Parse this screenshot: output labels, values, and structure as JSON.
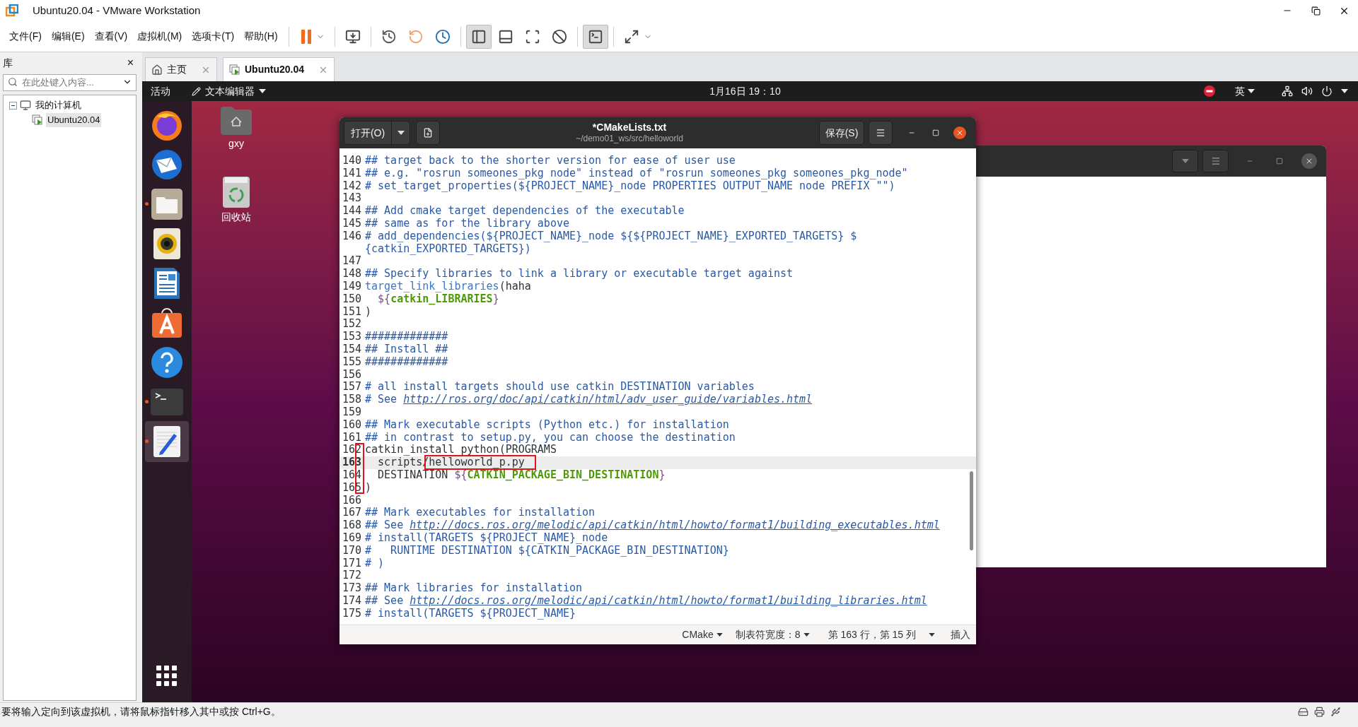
{
  "window": {
    "title": "Ubuntu20.04 - VMware Workstation"
  },
  "menu": [
    "文件(F)",
    "编辑(E)",
    "查看(V)",
    "虚拟机(M)",
    "选项卡(T)",
    "帮助(H)"
  ],
  "toolbar": [
    {
      "kind": "pause",
      "selected": false
    },
    {
      "kind": "ctrl-alt-del",
      "selected": false
    },
    {
      "kind": "snapshot-take",
      "selected": false
    },
    {
      "kind": "snapshot-revert",
      "selected": false
    },
    {
      "kind": "snapshot-manager",
      "selected": false
    },
    {
      "kind": "view-library",
      "selected": true
    },
    {
      "kind": "view-thumbnails",
      "selected": false
    },
    {
      "kind": "view-fullscreen",
      "selected": false
    },
    {
      "kind": "view-unity",
      "selected": false
    },
    {
      "kind": "console",
      "selected": true
    },
    {
      "kind": "stretch",
      "selected": false
    }
  ],
  "library": {
    "title": "库",
    "close": "×",
    "search": {
      "placeholder": "在此处键入内容..."
    },
    "tree": [
      {
        "label": "我的计算机",
        "expanded": true,
        "selected": false,
        "children": [
          {
            "label": "Ubuntu20.04",
            "selected": true
          }
        ]
      }
    ]
  },
  "tabs": [
    {
      "label": "主页",
      "kind": "home",
      "selected": false
    },
    {
      "label": "Ubuntu20.04",
      "kind": "vm",
      "selected": true
    }
  ],
  "ubuntu_bar": {
    "activities": "活动",
    "app_menu": "文本编辑器",
    "clock": "1月16日 19：10",
    "input_method": "英"
  },
  "dock": [
    {
      "kind": "browser",
      "running": false,
      "selected": false
    },
    {
      "kind": "mail",
      "running": false,
      "selected": false
    },
    {
      "kind": "files",
      "running": true,
      "selected": false
    },
    {
      "kind": "music",
      "running": false,
      "selected": false
    },
    {
      "kind": "writer",
      "running": false,
      "selected": false
    },
    {
      "kind": "software",
      "running": false,
      "selected": false
    },
    {
      "kind": "help",
      "running": false,
      "selected": false
    },
    {
      "kind": "terminal",
      "running": true,
      "selected": false
    },
    {
      "kind": "editor",
      "running": true,
      "selected": true
    }
  ],
  "desktop_icons": [
    {
      "kind": "home",
      "label": "gxy"
    },
    {
      "kind": "trash",
      "label": "回收站"
    }
  ],
  "editor": {
    "open_button": "打开(O)",
    "title": "*CMakeLists.txt",
    "subtitle": "~/demo01_ws/src/helloworld",
    "save_button": "保存(S)",
    "lines": [
      {
        "number": "140",
        "segments": [
          {
            "kind": "comment",
            "text": "## target back to the shorter version for ease of user use"
          }
        ]
      },
      {
        "number": "141",
        "segments": [
          {
            "kind": "comment",
            "text": "## e.g. \"rosrun someones_pkg node\" instead of \"rosrun someones_pkg someones_pkg_node\""
          }
        ]
      },
      {
        "number": "142",
        "segments": [
          {
            "kind": "comment",
            "text": "# set_target_properties(${PROJECT_NAME}_node PROPERTIES OUTPUT_NAME node PREFIX \"\")"
          }
        ]
      },
      {
        "number": "143"
      },
      {
        "number": "144",
        "segments": [
          {
            "kind": "comment",
            "text": "## Add cmake target dependencies of the executable"
          }
        ]
      },
      {
        "number": "145",
        "segments": [
          {
            "kind": "comment",
            "text": "## same as for the library above"
          }
        ]
      },
      {
        "number": "146",
        "segments": [
          {
            "kind": "comment",
            "text": "# add_dependencies(${PROJECT_NAME}_node ${${PROJECT_NAME}_EXPORTED_TARGETS} $"
          }
        ]
      },
      {
        "segments": [
          {
            "kind": "comment",
            "text": "{catkin_EXPORTED_TARGETS})"
          }
        ]
      },
      {
        "number": "147"
      },
      {
        "number": "148",
        "segments": [
          {
            "kind": "comment",
            "text": "## Specify libraries to link a library or executable target against"
          }
        ]
      },
      {
        "number": "149",
        "segments": [
          {
            "kind": "function",
            "text": "target_link_libraries"
          },
          {
            "kind": "plain",
            "text": "(haha"
          }
        ]
      },
      {
        "number": "150",
        "segments": [
          {
            "kind": "brace",
            "text": "  ${"
          },
          {
            "kind": "variable",
            "text": "catkin_LIBRARIES"
          },
          {
            "kind": "brace",
            "text": "}"
          }
        ]
      },
      {
        "number": "151",
        "segments": [
          {
            "kind": "plain",
            "text": ")"
          }
        ]
      },
      {
        "number": "152"
      },
      {
        "number": "153",
        "segments": [
          {
            "kind": "comment",
            "text": "#############"
          }
        ]
      },
      {
        "number": "154",
        "segments": [
          {
            "kind": "comment",
            "text": "## Install ##"
          }
        ]
      },
      {
        "number": "155",
        "segments": [
          {
            "kind": "comment",
            "text": "#############"
          }
        ]
      },
      {
        "number": "156"
      },
      {
        "number": "157",
        "segments": [
          {
            "kind": "comment",
            "text": "# all install targets should use catkin DESTINATION variables"
          }
        ]
      },
      {
        "number": "158",
        "segments": [
          {
            "kind": "comment",
            "text": "# See "
          },
          {
            "kind": "link",
            "text": "http://ros.org/doc/api/catkin/html/adv_user_guide/variables.html"
          }
        ]
      },
      {
        "number": "159"
      },
      {
        "number": "160",
        "segments": [
          {
            "kind": "comment",
            "text": "## Mark executable scripts (Python etc.) for installation"
          }
        ]
      },
      {
        "number": "161",
        "segments": [
          {
            "kind": "comment",
            "text": "## in contrast to setup.py, you can choose the destination"
          }
        ]
      },
      {
        "number": "162",
        "segments": [
          {
            "kind": "plain",
            "text": "catkin_install_python(PROGRAMS"
          }
        ]
      },
      {
        "number": "163",
        "current": true,
        "segments": [
          {
            "kind": "plain",
            "text": "  scripts/helloworld_p.py"
          }
        ]
      },
      {
        "number": "164",
        "segments": [
          {
            "kind": "plain",
            "text": "  DESTINATION "
          },
          {
            "kind": "brace",
            "text": "${"
          },
          {
            "kind": "variable",
            "text": "CATKIN_PACKAGE_BIN_DESTINATION"
          },
          {
            "kind": "brace",
            "text": "}"
          }
        ]
      },
      {
        "number": "165",
        "segments": [
          {
            "kind": "plain",
            "text": ")"
          }
        ]
      },
      {
        "number": "166"
      },
      {
        "number": "167",
        "segments": [
          {
            "kind": "comment",
            "text": "## Mark executables for installation"
          }
        ]
      },
      {
        "number": "168",
        "segments": [
          {
            "kind": "comment",
            "text": "## See "
          },
          {
            "kind": "link",
            "text": "http://docs.ros.org/melodic/api/catkin/html/howto/format1/building_executables.html"
          }
        ]
      },
      {
        "number": "169",
        "segments": [
          {
            "kind": "comment",
            "text": "# install(TARGETS ${PROJECT_NAME}_node"
          }
        ]
      },
      {
        "number": "170",
        "segments": [
          {
            "kind": "comment",
            "text": "#   RUNTIME DESTINATION ${CATKIN_PACKAGE_BIN_DESTINATION}"
          }
        ]
      },
      {
        "number": "171",
        "segments": [
          {
            "kind": "comment",
            "text": "# )"
          }
        ]
      },
      {
        "number": "172"
      },
      {
        "number": "173",
        "segments": [
          {
            "kind": "comment",
            "text": "## Mark libraries for installation"
          }
        ]
      },
      {
        "number": "174",
        "segments": [
          {
            "kind": "comment",
            "text": "## See "
          },
          {
            "kind": "link",
            "text": "http://docs.ros.org/melodic/api/catkin/html/howto/format1/building_libraries.html"
          }
        ]
      },
      {
        "number": "175",
        "segments": [
          {
            "kind": "comment",
            "text": "# install(TARGETS ${PROJECT_NAME}"
          }
        ]
      }
    ],
    "status": {
      "language": "CMake",
      "tab_width": "制表符宽度：8",
      "position": "第 163 行，第 15 列",
      "mode": "插入"
    }
  },
  "status_bar": "要将输入定向到该虚拟机，请将鼠标指针移入其中或按 Ctrl+G。"
}
